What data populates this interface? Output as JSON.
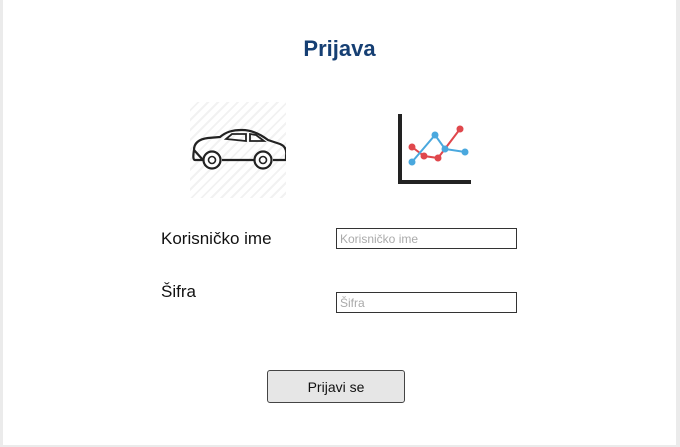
{
  "login": {
    "title": "Prijava",
    "username_label": "Korisničko ime",
    "username_placeholder": "Korisničko ime",
    "password_label": "Šifra",
    "password_placeholder": "Šifra",
    "submit_label": "Prijavi se"
  },
  "icons": {
    "car": "car-icon",
    "chart": "line-chart-icon"
  },
  "colors": {
    "title": "#163f73",
    "chart_red": "#e0474c",
    "chart_blue": "#4aa8de"
  }
}
